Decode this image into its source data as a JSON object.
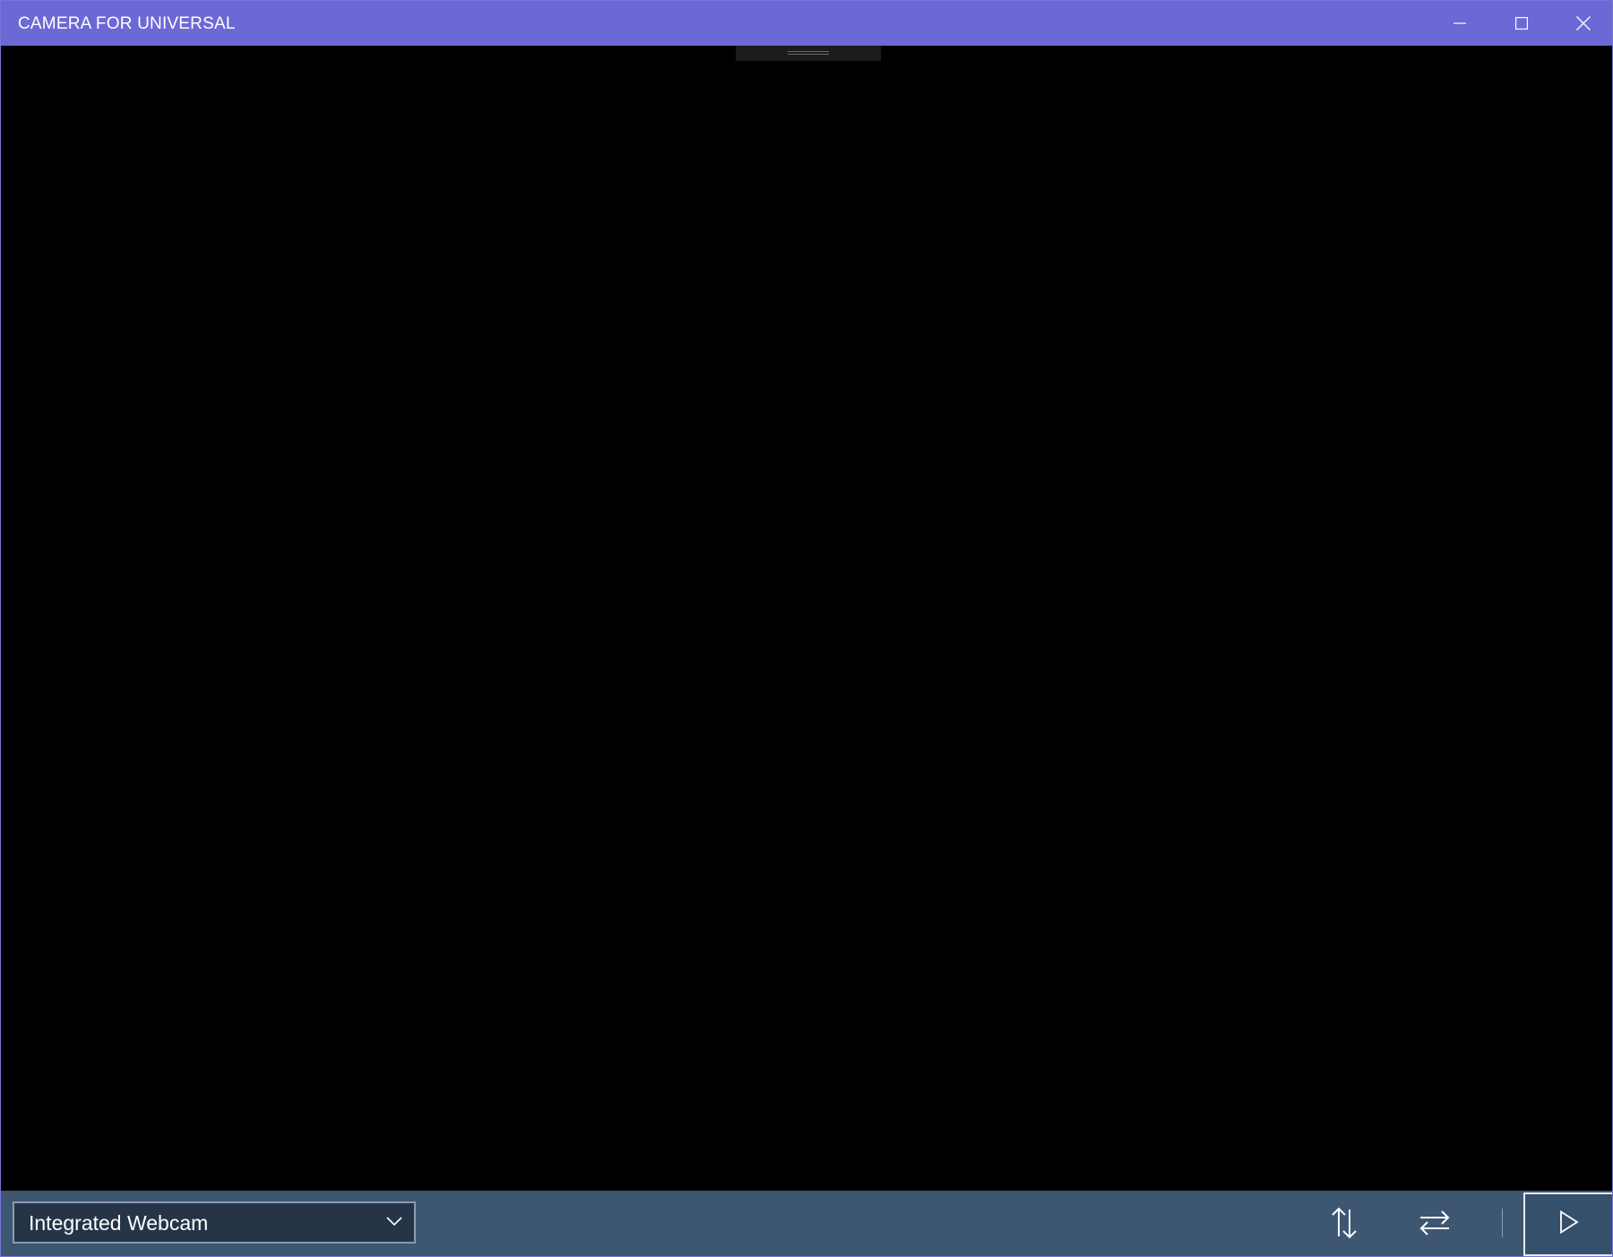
{
  "window": {
    "title": "CAMERA FOR UNIVERSAL",
    "titlebar_color": "#6c68d6",
    "controls": {
      "minimize_icon": "minimize-icon",
      "maximize_icon": "maximize-icon",
      "close_icon": "close-icon"
    }
  },
  "preview": {
    "background": "#000000",
    "handle_icon": "drag-handle-icon"
  },
  "toolbar": {
    "background": "#3d5672",
    "camera_select": {
      "selected": "Integrated Webcam",
      "icon": "chevron-down-icon"
    },
    "buttons": [
      {
        "name": "flip-vertical",
        "icon": "flip-vertical-icon"
      },
      {
        "name": "flip-horizontal",
        "icon": "flip-horizontal-icon"
      },
      {
        "name": "play",
        "icon": "play-icon"
      }
    ]
  }
}
